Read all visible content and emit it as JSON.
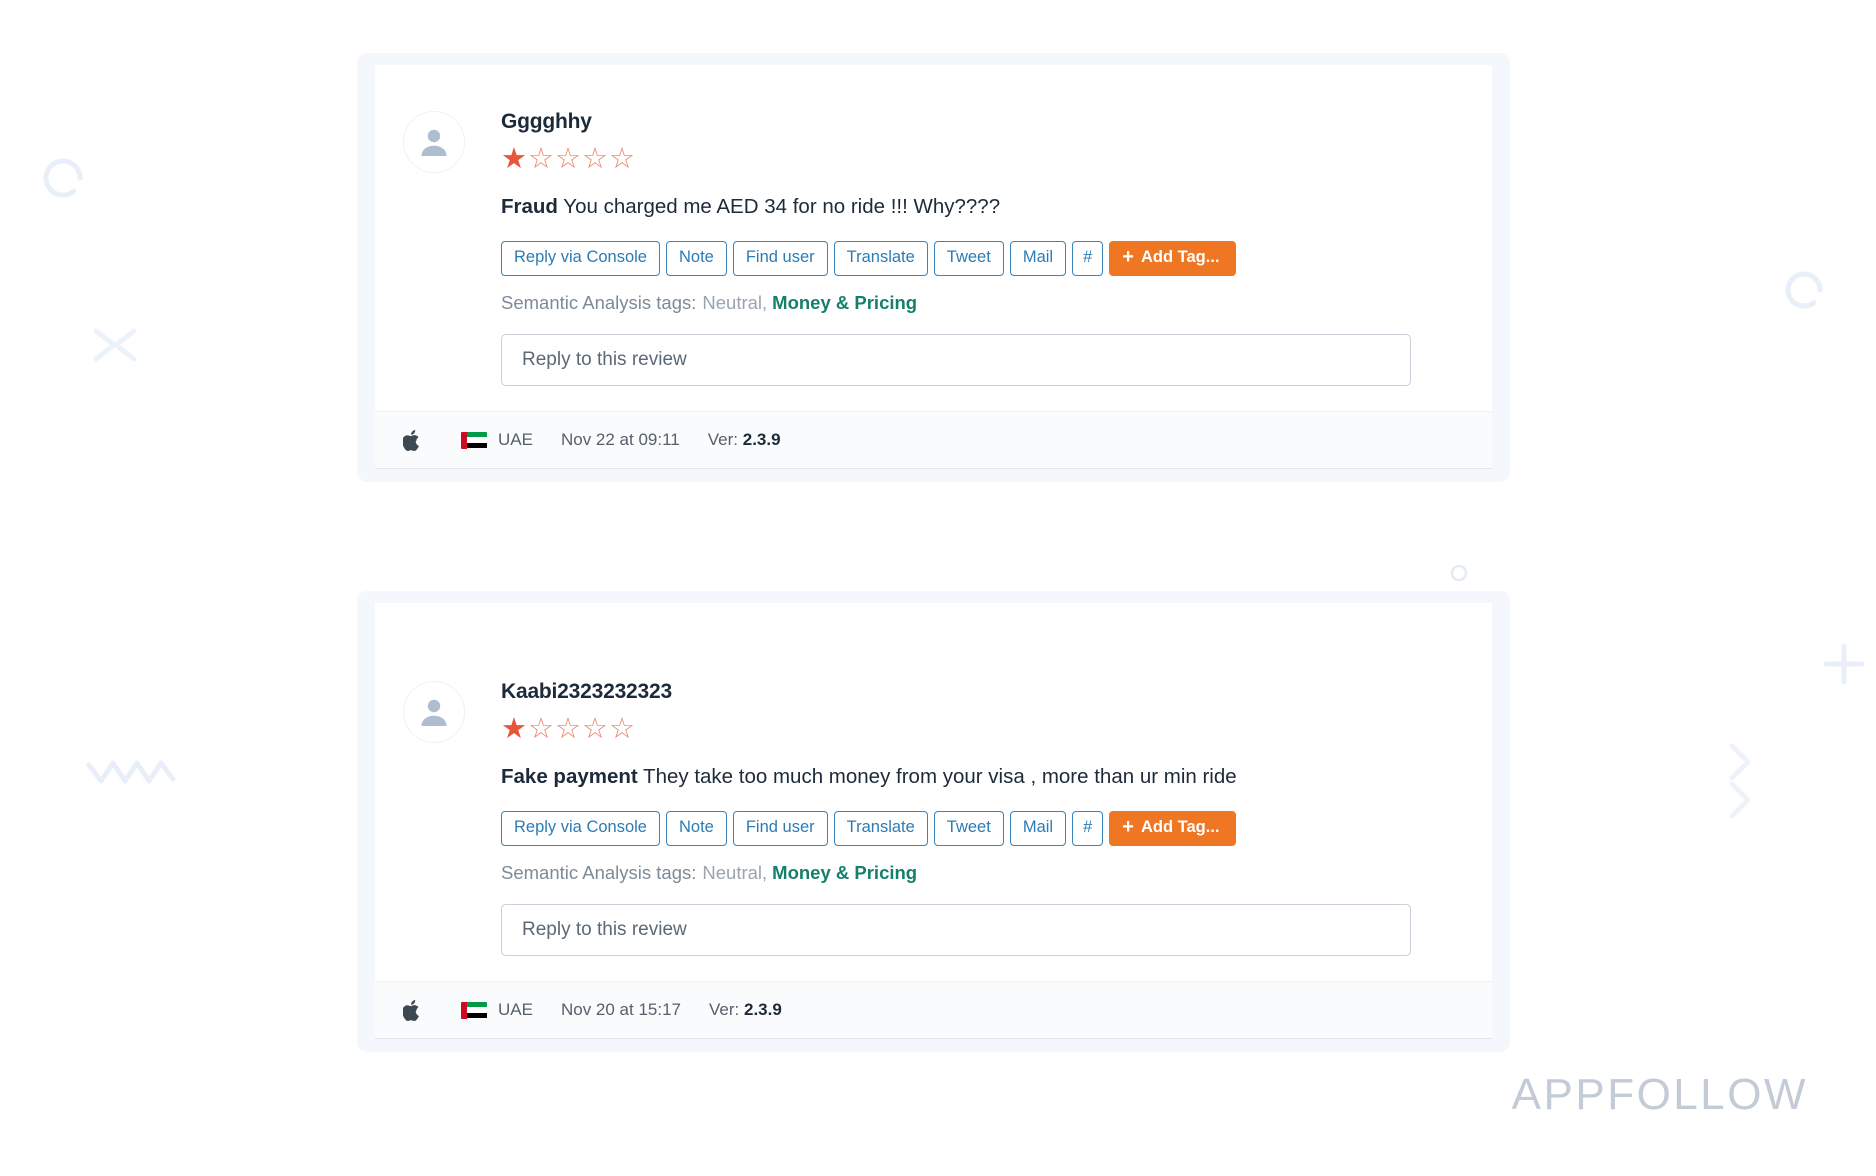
{
  "watermark": "APPFOLLOW",
  "icons": {
    "avatar": "user-avatar-icon",
    "platform": "apple-icon",
    "flag": "uae-flag-icon",
    "add_tag_plus": "plus-icon"
  },
  "actions": {
    "reply_via_console": "Reply via Console",
    "note": "Note",
    "find_user": "Find user",
    "translate": "Translate",
    "tweet": "Tweet",
    "mail": "Mail",
    "hash": "#",
    "add_tag": "Add Tag...",
    "add_tag_plus": "+"
  },
  "semantic": {
    "label": "Semantic Analysis tags:",
    "neutral": "Neutral,",
    "tag": "Money & Pricing"
  },
  "reply": {
    "placeholder": "Reply to this review"
  },
  "footer_labels": {
    "version_label": "Ver:"
  },
  "colors": {
    "accent_orange": "#ef7622",
    "star_filled": "#e8563a",
    "star_empty": "#ec8467",
    "link_blue": "#2b7cb5",
    "tag_green": "#157f6b",
    "muted_gray": "#7e8a97"
  },
  "reviews": [
    {
      "author": "Gggghhy",
      "rating": 1,
      "rating_max": 5,
      "stars_filled": "★",
      "stars_empty": "☆☆☆☆",
      "title": "Fraud",
      "body": " You charged me AED 34 for no ride !!! Why????",
      "country": "UAE",
      "date": "Nov 22 at 09:11",
      "version": "2.3.9"
    },
    {
      "author": "Kaabi2323232323",
      "rating": 1,
      "rating_max": 5,
      "stars_filled": "★",
      "stars_empty": "☆☆☆☆",
      "title": "Fake payment",
      "body": " They take too much money from your visa , more than ur min ride",
      "country": "UAE",
      "date": "Nov 20 at 15:17",
      "version": "2.3.9"
    }
  ]
}
